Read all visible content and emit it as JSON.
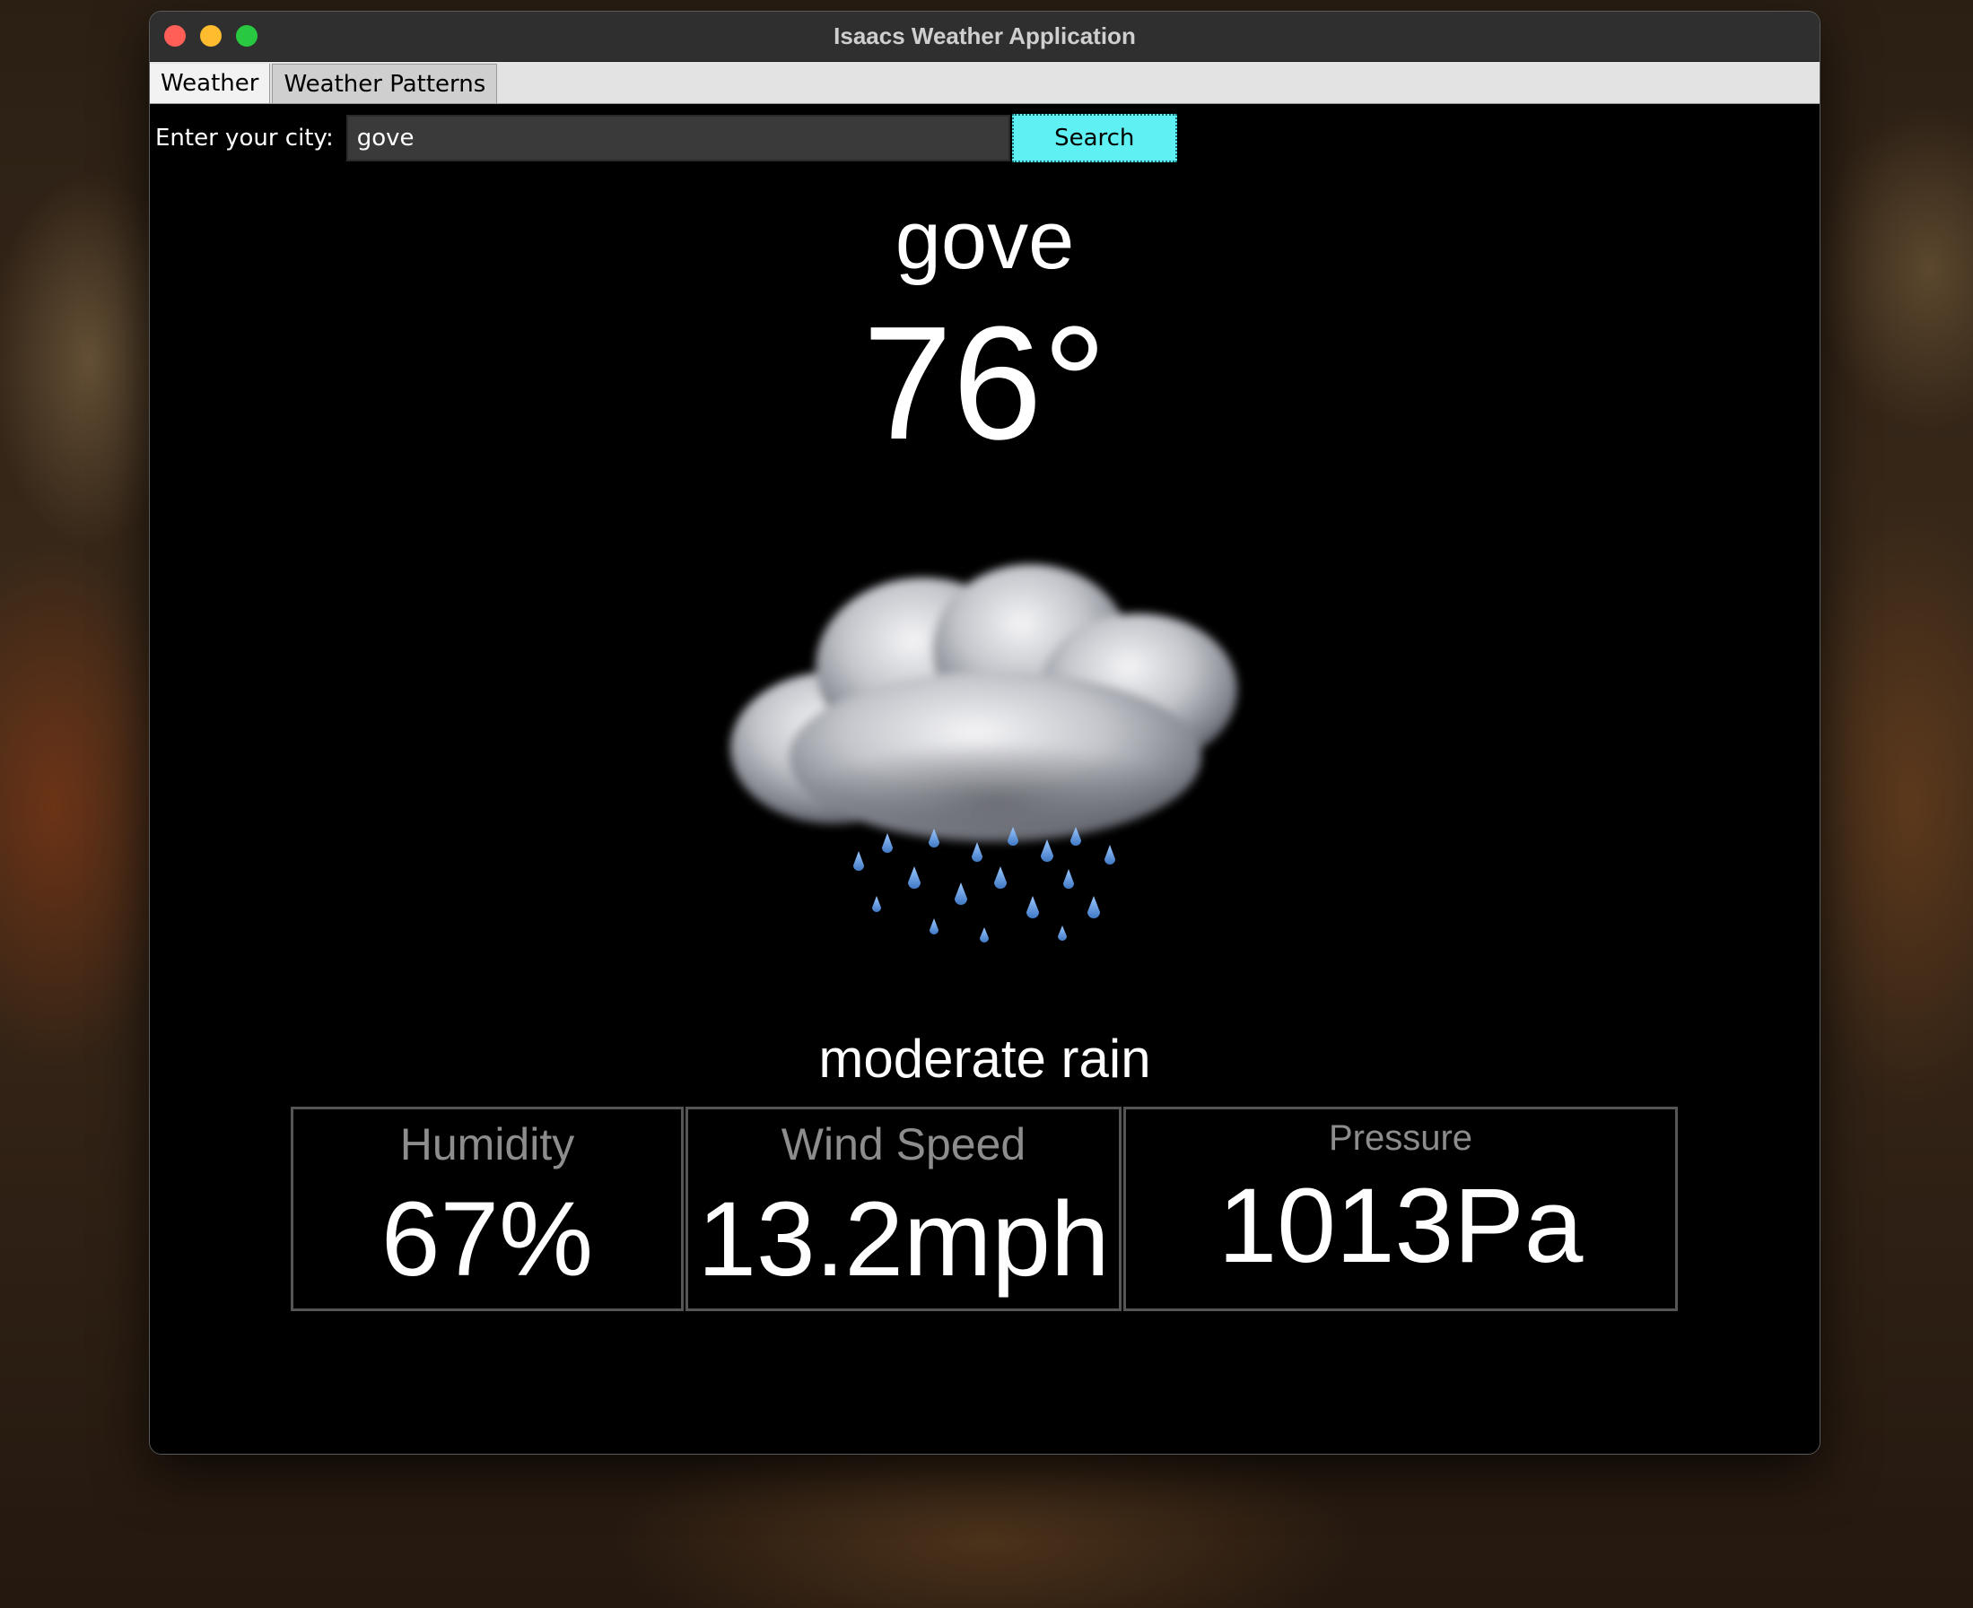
{
  "window": {
    "title": "Isaacs Weather Application"
  },
  "tabs": [
    {
      "label": "Weather",
      "active": true
    },
    {
      "label": "Weather Patterns",
      "active": false
    }
  ],
  "search": {
    "label": "Enter your city:",
    "value": "gove",
    "button_label": "Search",
    "button_color": "#5ef0f2"
  },
  "weather": {
    "city": "gove",
    "temperature": "76°",
    "condition": "moderate rain",
    "icon": "cloud-rain-icon"
  },
  "stats": {
    "humidity": {
      "label": "Humidity",
      "value": "67%"
    },
    "wind_speed": {
      "label": "Wind Speed",
      "value": "13.2mph"
    },
    "pressure": {
      "label": "Pressure",
      "value": "1013Pa"
    }
  }
}
